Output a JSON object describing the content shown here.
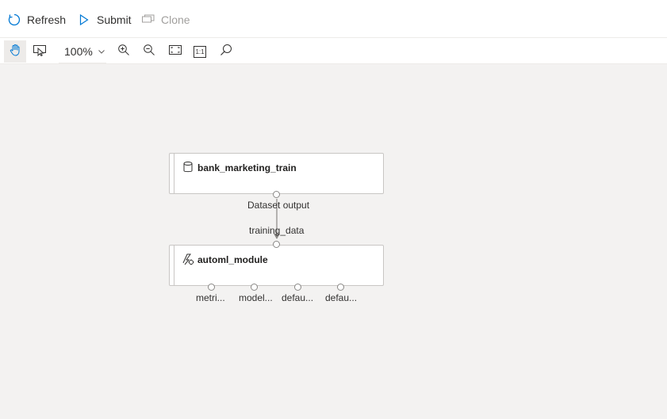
{
  "commands": {
    "refresh": "Refresh",
    "submit": "Submit",
    "clone": "Clone"
  },
  "toolbar": {
    "zoom": "100%",
    "actual_size": "1:1"
  },
  "nodes": [
    {
      "title": "bank_marketing_train",
      "icon": "dataset-icon",
      "output_ports": [
        "Dataset output"
      ]
    },
    {
      "title": "automl_module",
      "icon": "automl-icon",
      "input_ports": [
        "training_data"
      ],
      "output_ports": [
        "metri...",
        "model...",
        "defau...",
        "defau..."
      ]
    }
  ],
  "colors": {
    "accent": "#0078d4",
    "canvas_bg": "#f3f2f1",
    "edge": "#8a8886"
  }
}
